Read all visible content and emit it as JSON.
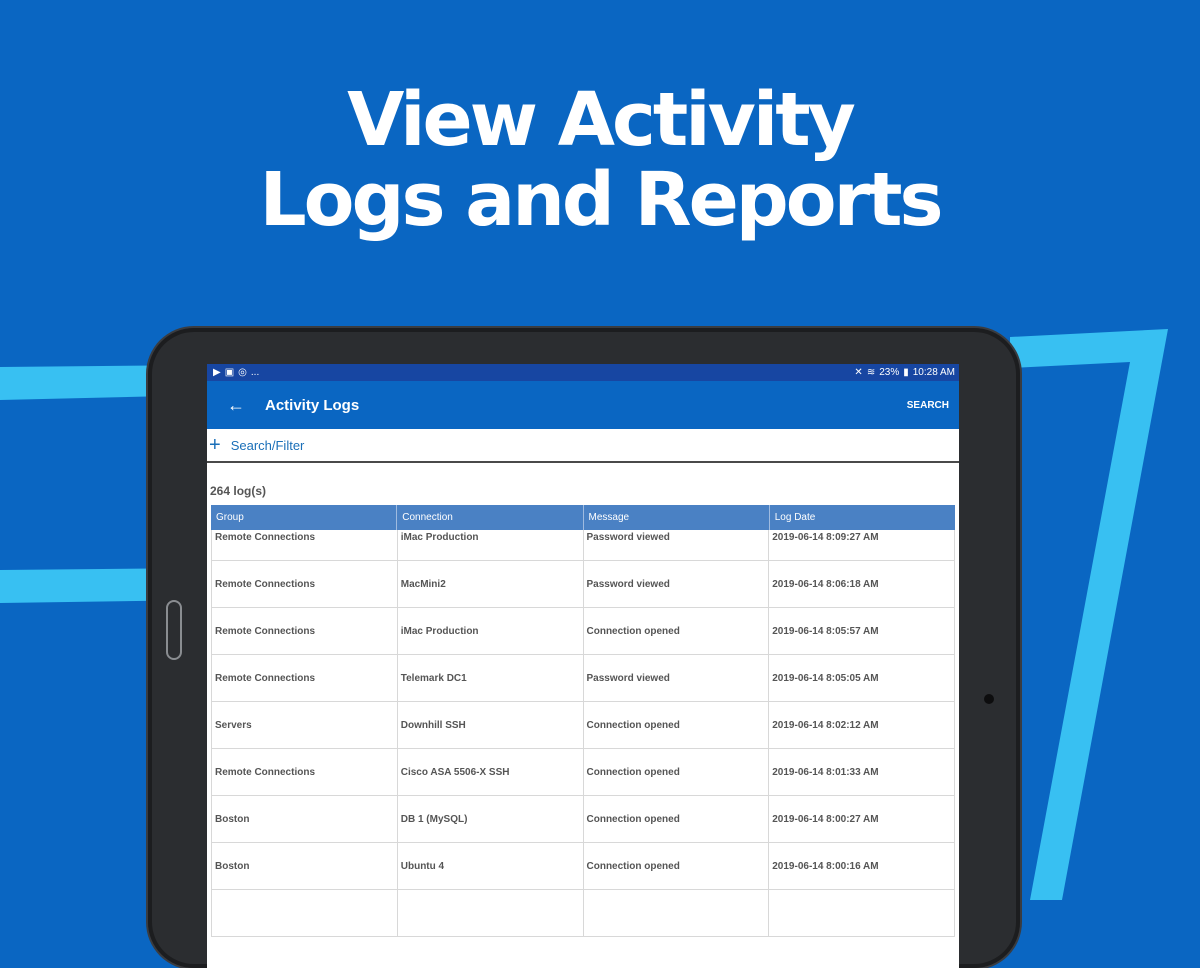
{
  "headline": {
    "line1": "View Activity",
    "line2": "Logs and Reports"
  },
  "colors": {
    "background": "#0a66c2",
    "accent_stripe": "#38c0f2",
    "status_bar": "#1746a2",
    "app_bar": "#0a66c2",
    "table_header": "#4a81c4"
  },
  "statusbar": {
    "left_icons": [
      "play-store-icon",
      "image-icon",
      "sync-icon"
    ],
    "more": "...",
    "right_icons": [
      "mute-icon",
      "wifi-icon",
      "battery-icon"
    ],
    "battery": "23%",
    "time": "10:28 AM"
  },
  "appbar": {
    "title": "Activity Logs",
    "search_label": "SEARCH"
  },
  "filter": {
    "label": "Search/Filter"
  },
  "log_count": "264 log(s)",
  "table": {
    "columns": [
      "Group",
      "Connection",
      "Message",
      "Log Date"
    ],
    "rows": [
      [
        "Remote Connections",
        "iMac Production",
        "Password viewed",
        "2019-06-14 8:09:27 AM"
      ],
      [
        "Remote Connections",
        "MacMini2",
        "Password viewed",
        "2019-06-14 8:06:18 AM"
      ],
      [
        "Remote Connections",
        "iMac Production",
        "Connection opened",
        "2019-06-14 8:05:57 AM"
      ],
      [
        "Remote Connections",
        "Telemark DC1",
        "Password viewed",
        "2019-06-14 8:05:05 AM"
      ],
      [
        "Servers",
        "Downhill SSH",
        "Connection opened",
        "2019-06-14 8:02:12 AM"
      ],
      [
        "Remote Connections",
        "Cisco ASA 5506-X SSH",
        "Connection opened",
        "2019-06-14 8:01:33 AM"
      ],
      [
        "Boston",
        "DB 1 (MySQL)",
        "Connection opened",
        "2019-06-14 8:00:27 AM"
      ],
      [
        "Boston",
        "Ubuntu 4",
        "Connection opened",
        "2019-06-14 8:00:16 AM"
      ],
      [
        "",
        "",
        "",
        ""
      ]
    ]
  }
}
